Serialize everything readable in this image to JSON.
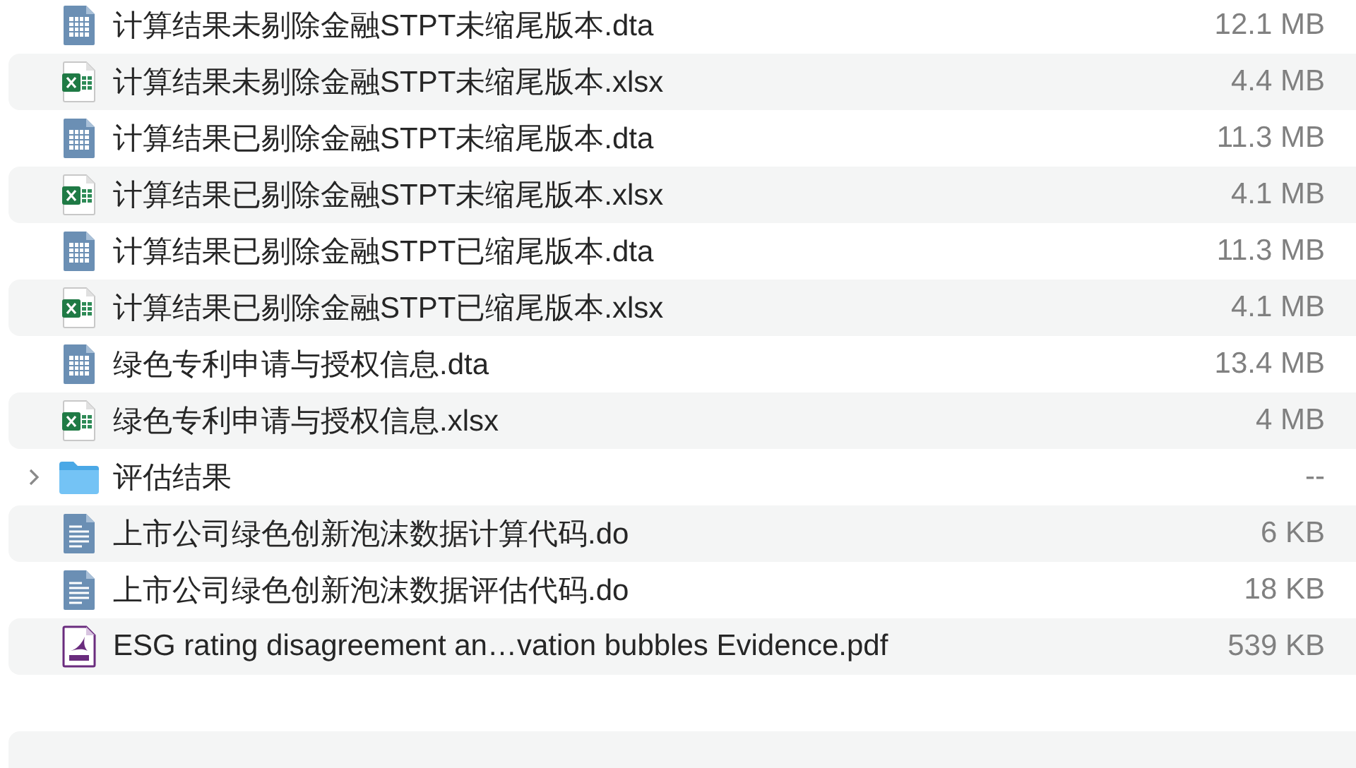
{
  "files": [
    {
      "kind": "dta",
      "name": "计算结果未剔除金融STPT未缩尾版本.dta",
      "size": "12.1 MB"
    },
    {
      "kind": "xlsx",
      "name": "计算结果未剔除金融STPT未缩尾版本.xlsx",
      "size": "4.4 MB"
    },
    {
      "kind": "dta",
      "name": "计算结果已剔除金融STPT未缩尾版本.dta",
      "size": "11.3 MB"
    },
    {
      "kind": "xlsx",
      "name": "计算结果已剔除金融STPT未缩尾版本.xlsx",
      "size": "4.1 MB"
    },
    {
      "kind": "dta",
      "name": "计算结果已剔除金融STPT已缩尾版本.dta",
      "size": "11.3 MB"
    },
    {
      "kind": "xlsx",
      "name": "计算结果已剔除金融STPT已缩尾版本.xlsx",
      "size": "4.1 MB"
    },
    {
      "kind": "dta",
      "name": "绿色专利申请与授权信息.dta",
      "size": "13.4 MB"
    },
    {
      "kind": "xlsx",
      "name": "绿色专利申请与授权信息.xlsx",
      "size": "4 MB"
    },
    {
      "kind": "folder",
      "name": "评估结果",
      "size": "--",
      "expanded": false
    },
    {
      "kind": "do",
      "name": "上市公司绿色创新泡沫数据计算代码.do",
      "size": "6 KB"
    },
    {
      "kind": "do",
      "name": "上市公司绿色创新泡沫数据评估代码.do",
      "size": "18 KB"
    },
    {
      "kind": "pdf",
      "name": "ESG rating disagreement an…vation bubbles Evidence.pdf",
      "size": "539 KB"
    }
  ]
}
